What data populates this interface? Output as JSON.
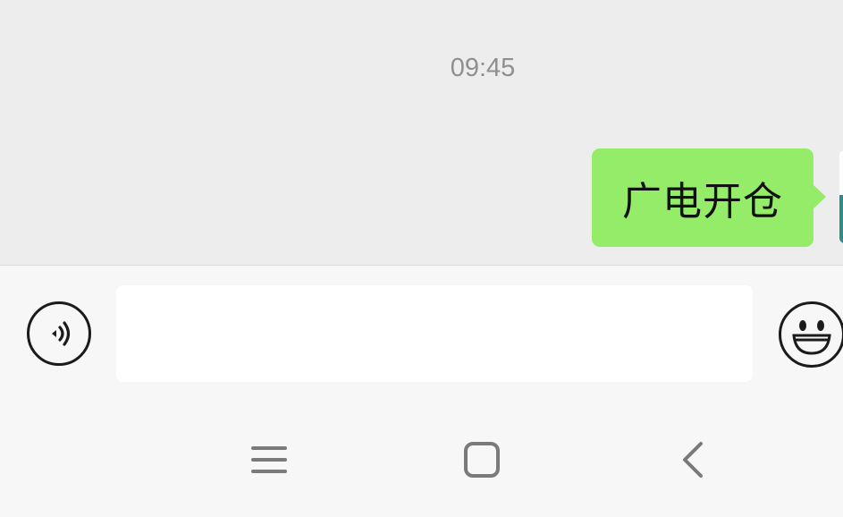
{
  "chat": {
    "timestamp": "09:45",
    "messages": [
      {
        "sender": "self",
        "text": "广电开仓"
      }
    ]
  },
  "composer": {
    "voice_icon": "voice-input-icon",
    "input_value": "",
    "emoji_icon": "emoji-icon"
  },
  "nav": {
    "menu_icon": "menu-icon",
    "home_icon": "home-icon",
    "back_icon": "back-icon"
  },
  "colors": {
    "chat_background": "#ededed",
    "bubble_self": "#95ec69",
    "input_bar": "#f7f7f7",
    "timestamp_text": "#8f8f8f"
  }
}
